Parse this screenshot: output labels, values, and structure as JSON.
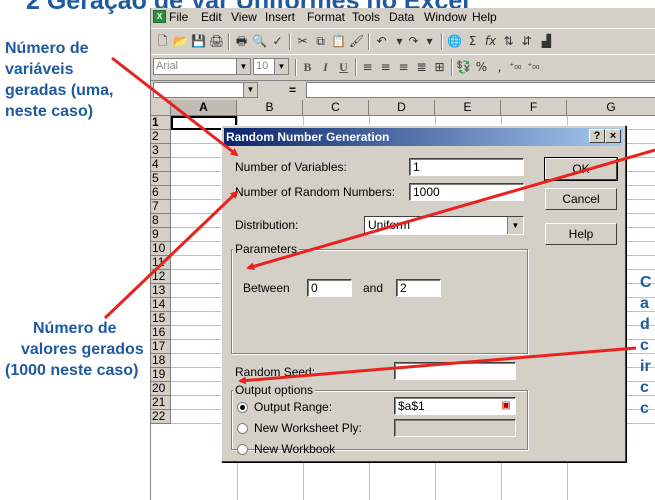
{
  "slide_title": "2 Geração de Var Uniformes no Excel",
  "excel": {
    "menu": [
      "File",
      "Edit",
      "View",
      "Insert",
      "Format",
      "Tools",
      "Data",
      "Window",
      "Help"
    ],
    "font_name": "Arial",
    "font_size": "10",
    "formula_eq": "=",
    "columns": [
      "A",
      "B",
      "C",
      "D",
      "E",
      "F",
      "G"
    ],
    "rows": [
      "1",
      "2",
      "3",
      "4",
      "5",
      "6",
      "7",
      "8",
      "9",
      "10",
      "11",
      "12",
      "13",
      "14",
      "15",
      "16",
      "17",
      "18",
      "19",
      "20",
      "21",
      "22"
    ]
  },
  "dialog": {
    "title": "Random Number Generation",
    "help_glyph": "?",
    "close_glyph": "×",
    "num_variables_label": "Number of Variables:",
    "num_variables_value": "1",
    "num_random_label": "Number of Random Numbers:",
    "num_random_value": "1000",
    "distribution_label": "Distribution:",
    "distribution_value": "Uniform",
    "parameters_label": "Parameters",
    "between_label": "Between",
    "between_value": "0",
    "and_label": "and",
    "and_value": "2",
    "random_seed_label": "Random Seed:",
    "random_seed_value": "",
    "output_options_label": "Output options",
    "output_range_label": "Output Range:",
    "output_range_value": "$a$1",
    "new_ply_label": "New Worksheet Ply:",
    "new_workbook_label": "New Workbook",
    "ok_label": "OK",
    "cancel_label": "Cancel",
    "help_label": "Help"
  },
  "annotations": {
    "num_variables": [
      "Número de",
      "variáveis",
      "geradas (uma,",
      "neste caso)"
    ],
    "num_values": [
      "Número de",
      "valores gerados",
      "(1000 neste caso)"
    ],
    "right_side": [
      "C",
      "a",
      "d",
      "c",
      "ir",
      "c",
      "c"
    ]
  },
  "colors": {
    "annotation": "#1f5a9e",
    "arrow": "#e8231f",
    "titlebar": "#0a246a"
  }
}
